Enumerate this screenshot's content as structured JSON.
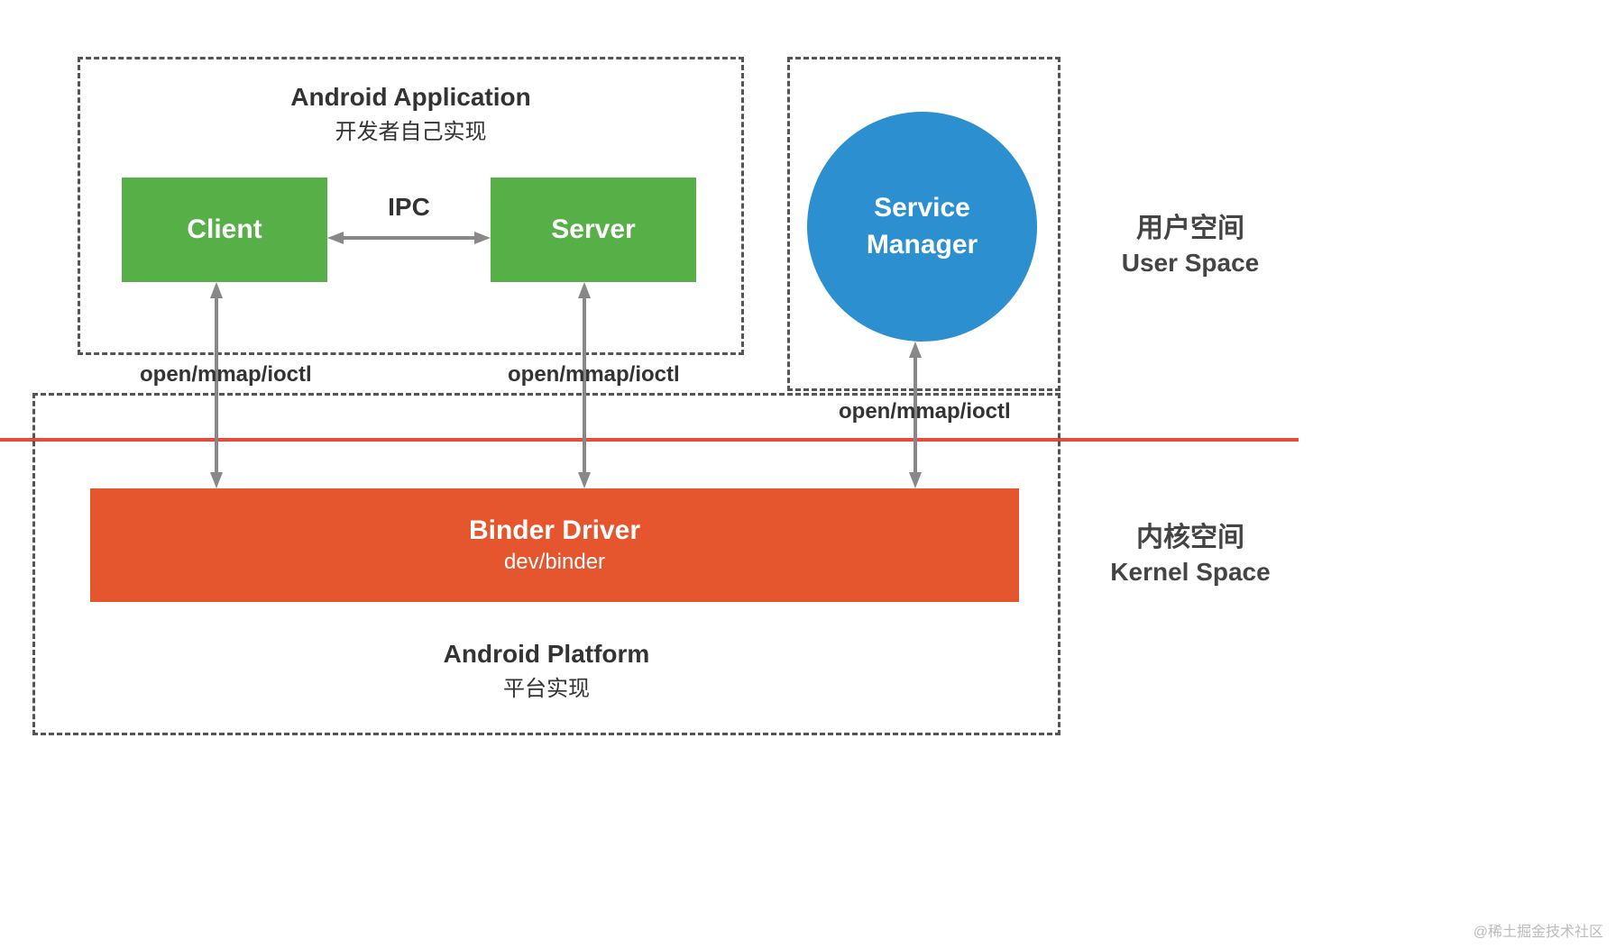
{
  "app_box": {
    "title": "Android Application",
    "subtitle": "开发者自己实现"
  },
  "client_box": {
    "label": "Client"
  },
  "server_box": {
    "label": "Server"
  },
  "ipc": {
    "label": "IPC"
  },
  "service_manager": {
    "label": "Service\nManager"
  },
  "user_space": {
    "cn": "用户空间",
    "en": "User Space"
  },
  "kernel_space": {
    "cn": "内核空间",
    "en": "Kernel Space"
  },
  "binder": {
    "title": "Binder Driver",
    "subtitle": "dev/binder"
  },
  "platform_box": {
    "title": "Android Platform",
    "subtitle": "平台实现"
  },
  "syscall": {
    "client": "open/mmap/ioctl",
    "server": "open/mmap/ioctl",
    "manager": "open/mmap/ioctl"
  },
  "watermark": "@稀土掘金技术社区"
}
